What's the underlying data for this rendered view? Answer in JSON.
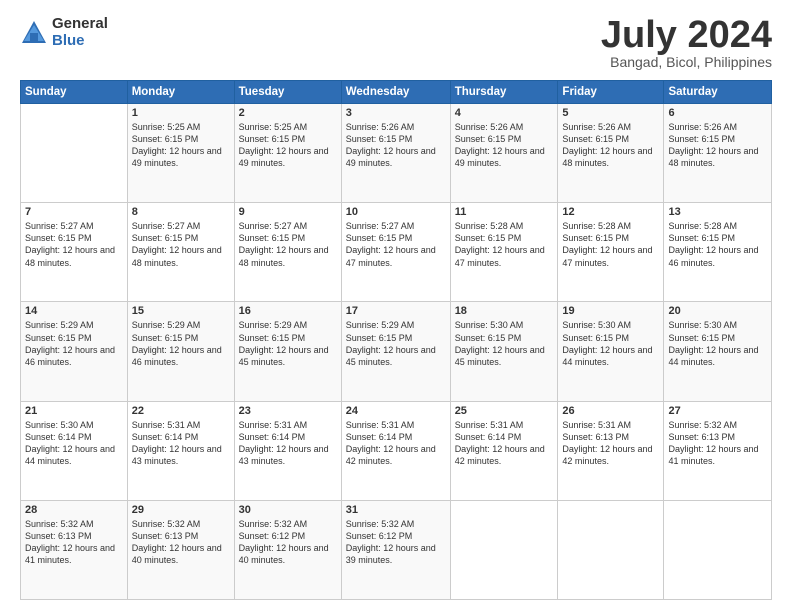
{
  "logo": {
    "general": "General",
    "blue": "Blue"
  },
  "title": "July 2024",
  "subtitle": "Bangad, Bicol, Philippines",
  "days_of_week": [
    "Sunday",
    "Monday",
    "Tuesday",
    "Wednesday",
    "Thursday",
    "Friday",
    "Saturday"
  ],
  "weeks": [
    [
      {
        "day": "",
        "info": ""
      },
      {
        "day": "1",
        "info": "Sunrise: 5:25 AM\nSunset: 6:15 PM\nDaylight: 12 hours\nand 49 minutes."
      },
      {
        "day": "2",
        "info": "Sunrise: 5:25 AM\nSunset: 6:15 PM\nDaylight: 12 hours\nand 49 minutes."
      },
      {
        "day": "3",
        "info": "Sunrise: 5:26 AM\nSunset: 6:15 PM\nDaylight: 12 hours\nand 49 minutes."
      },
      {
        "day": "4",
        "info": "Sunrise: 5:26 AM\nSunset: 6:15 PM\nDaylight: 12 hours\nand 49 minutes."
      },
      {
        "day": "5",
        "info": "Sunrise: 5:26 AM\nSunset: 6:15 PM\nDaylight: 12 hours\nand 48 minutes."
      },
      {
        "day": "6",
        "info": "Sunrise: 5:26 AM\nSunset: 6:15 PM\nDaylight: 12 hours\nand 48 minutes."
      }
    ],
    [
      {
        "day": "7",
        "info": "Sunrise: 5:27 AM\nSunset: 6:15 PM\nDaylight: 12 hours\nand 48 minutes."
      },
      {
        "day": "8",
        "info": "Sunrise: 5:27 AM\nSunset: 6:15 PM\nDaylight: 12 hours\nand 48 minutes."
      },
      {
        "day": "9",
        "info": "Sunrise: 5:27 AM\nSunset: 6:15 PM\nDaylight: 12 hours\nand 48 minutes."
      },
      {
        "day": "10",
        "info": "Sunrise: 5:27 AM\nSunset: 6:15 PM\nDaylight: 12 hours\nand 47 minutes."
      },
      {
        "day": "11",
        "info": "Sunrise: 5:28 AM\nSunset: 6:15 PM\nDaylight: 12 hours\nand 47 minutes."
      },
      {
        "day": "12",
        "info": "Sunrise: 5:28 AM\nSunset: 6:15 PM\nDaylight: 12 hours\nand 47 minutes."
      },
      {
        "day": "13",
        "info": "Sunrise: 5:28 AM\nSunset: 6:15 PM\nDaylight: 12 hours\nand 46 minutes."
      }
    ],
    [
      {
        "day": "14",
        "info": "Sunrise: 5:29 AM\nSunset: 6:15 PM\nDaylight: 12 hours\nand 46 minutes."
      },
      {
        "day": "15",
        "info": "Sunrise: 5:29 AM\nSunset: 6:15 PM\nDaylight: 12 hours\nand 46 minutes."
      },
      {
        "day": "16",
        "info": "Sunrise: 5:29 AM\nSunset: 6:15 PM\nDaylight: 12 hours\nand 45 minutes."
      },
      {
        "day": "17",
        "info": "Sunrise: 5:29 AM\nSunset: 6:15 PM\nDaylight: 12 hours\nand 45 minutes."
      },
      {
        "day": "18",
        "info": "Sunrise: 5:30 AM\nSunset: 6:15 PM\nDaylight: 12 hours\nand 45 minutes."
      },
      {
        "day": "19",
        "info": "Sunrise: 5:30 AM\nSunset: 6:15 PM\nDaylight: 12 hours\nand 44 minutes."
      },
      {
        "day": "20",
        "info": "Sunrise: 5:30 AM\nSunset: 6:15 PM\nDaylight: 12 hours\nand 44 minutes."
      }
    ],
    [
      {
        "day": "21",
        "info": "Sunrise: 5:30 AM\nSunset: 6:14 PM\nDaylight: 12 hours\nand 44 minutes."
      },
      {
        "day": "22",
        "info": "Sunrise: 5:31 AM\nSunset: 6:14 PM\nDaylight: 12 hours\nand 43 minutes."
      },
      {
        "day": "23",
        "info": "Sunrise: 5:31 AM\nSunset: 6:14 PM\nDaylight: 12 hours\nand 43 minutes."
      },
      {
        "day": "24",
        "info": "Sunrise: 5:31 AM\nSunset: 6:14 PM\nDaylight: 12 hours\nand 42 minutes."
      },
      {
        "day": "25",
        "info": "Sunrise: 5:31 AM\nSunset: 6:14 PM\nDaylight: 12 hours\nand 42 minutes."
      },
      {
        "day": "26",
        "info": "Sunrise: 5:31 AM\nSunset: 6:13 PM\nDaylight: 12 hours\nand 42 minutes."
      },
      {
        "day": "27",
        "info": "Sunrise: 5:32 AM\nSunset: 6:13 PM\nDaylight: 12 hours\nand 41 minutes."
      }
    ],
    [
      {
        "day": "28",
        "info": "Sunrise: 5:32 AM\nSunset: 6:13 PM\nDaylight: 12 hours\nand 41 minutes."
      },
      {
        "day": "29",
        "info": "Sunrise: 5:32 AM\nSunset: 6:13 PM\nDaylight: 12 hours\nand 40 minutes."
      },
      {
        "day": "30",
        "info": "Sunrise: 5:32 AM\nSunset: 6:12 PM\nDaylight: 12 hours\nand 40 minutes."
      },
      {
        "day": "31",
        "info": "Sunrise: 5:32 AM\nSunset: 6:12 PM\nDaylight: 12 hours\nand 39 minutes."
      },
      {
        "day": "",
        "info": ""
      },
      {
        "day": "",
        "info": ""
      },
      {
        "day": "",
        "info": ""
      }
    ]
  ]
}
